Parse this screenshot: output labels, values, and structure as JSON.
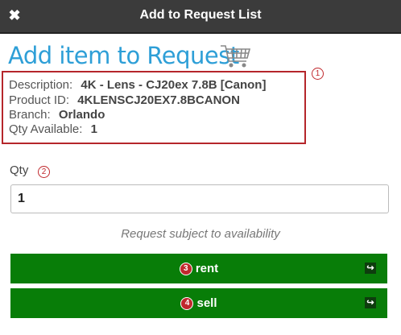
{
  "dialog": {
    "title": "Add to Request List",
    "close_glyph": "✖"
  },
  "heading": "Add item to Request",
  "cart_icon": "shopping-cart-icon",
  "item": {
    "description_label": "Description:",
    "description_value": "4K - Lens - CJ20ex 7.8B [Canon]",
    "product_id_label": "Product ID:",
    "product_id_value": "4KLENSCJ20EX7.8BCANON",
    "branch_label": "Branch:",
    "branch_value": "Orlando",
    "qty_available_label": "Qty Available:",
    "qty_available_value": "1"
  },
  "annotations": {
    "badge_1": "1",
    "badge_2": "2",
    "badge_3": "3",
    "badge_4": "4"
  },
  "qty": {
    "label": "Qty",
    "value": "1"
  },
  "note": "Request subject to availability",
  "buttons": {
    "rent_label": "rent",
    "sell_label": "sell",
    "arrow_glyph": "↪"
  },
  "colors": {
    "title_bar": "#3b3b3b",
    "heading": "#2e9fd7",
    "button_green": "#087d08",
    "highlight_red": "#b5262b"
  }
}
